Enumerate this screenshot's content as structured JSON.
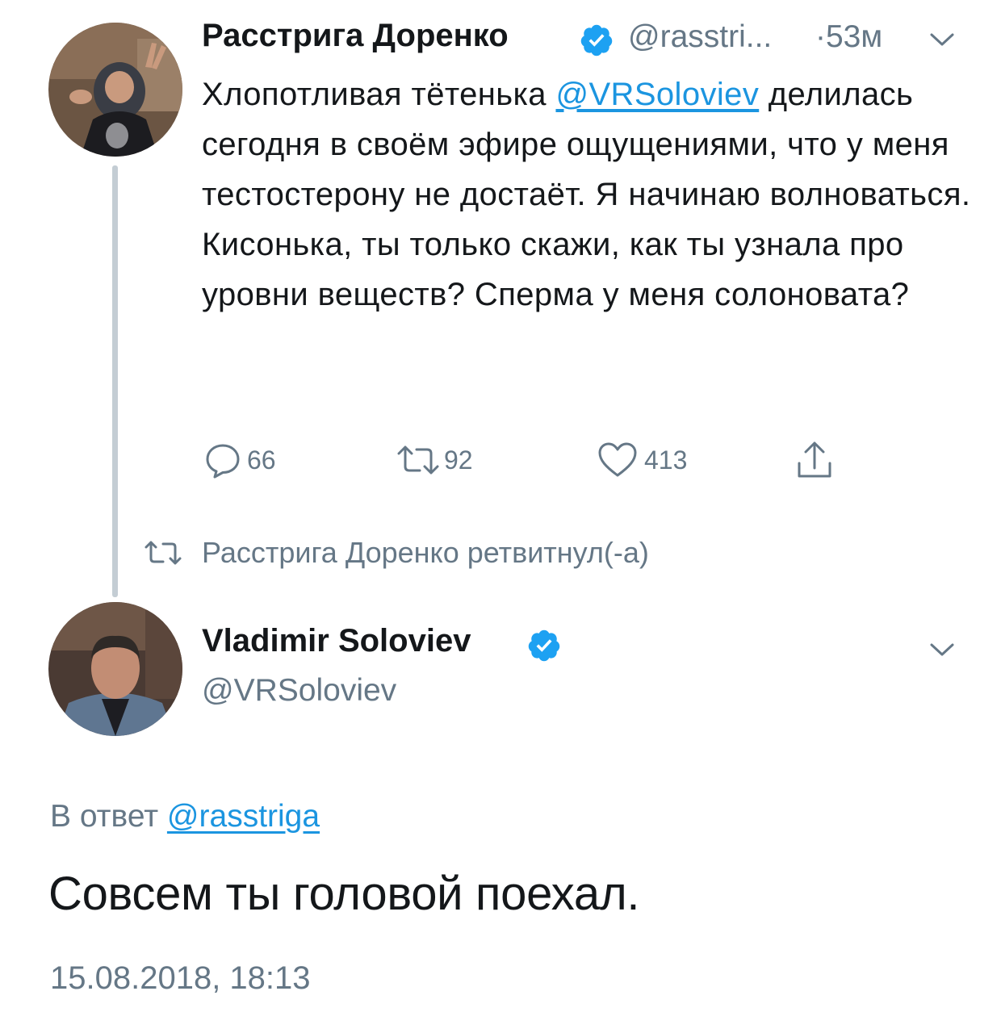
{
  "tweet1": {
    "author_name": "Расстрига Доренко",
    "handle": "@rasstri...",
    "time": "·53м",
    "body_part1": "Хлопотливая тётенька ",
    "body_mention": "@VRSoloviev",
    "body_part2": " делилась сегодня в своём эфире ощущениями, что у меня тестостерону не достаёт. Я начинаю волноваться. Кисонька, ты только скажи, как ты узнала про уровни веществ? Сперма у меня солоновата?",
    "replies": "66",
    "retweets": "92",
    "likes": "413"
  },
  "retweet_note": "Расстрига Доренко ретвитнул(-а)",
  "tweet2": {
    "author_name": "Vladimir Soloviev",
    "handle": "@VRSoloviev",
    "reply_prefix": "В ответ ",
    "reply_mention": "@rasstriga",
    "text": "Совсем ты головой поехал.",
    "timestamp": "15.08.2018, 18:13"
  },
  "icons": {
    "verified": "verified-badge-icon",
    "chevron": "chevron-down-icon",
    "reply": "reply-icon",
    "retweet": "retweet-icon",
    "like": "heart-icon",
    "share": "share-icon"
  },
  "colors": {
    "link": "#1b95e0",
    "verified": "#1da1f2",
    "secondary_text": "#657786",
    "thread_line": "#c4cdd4"
  }
}
